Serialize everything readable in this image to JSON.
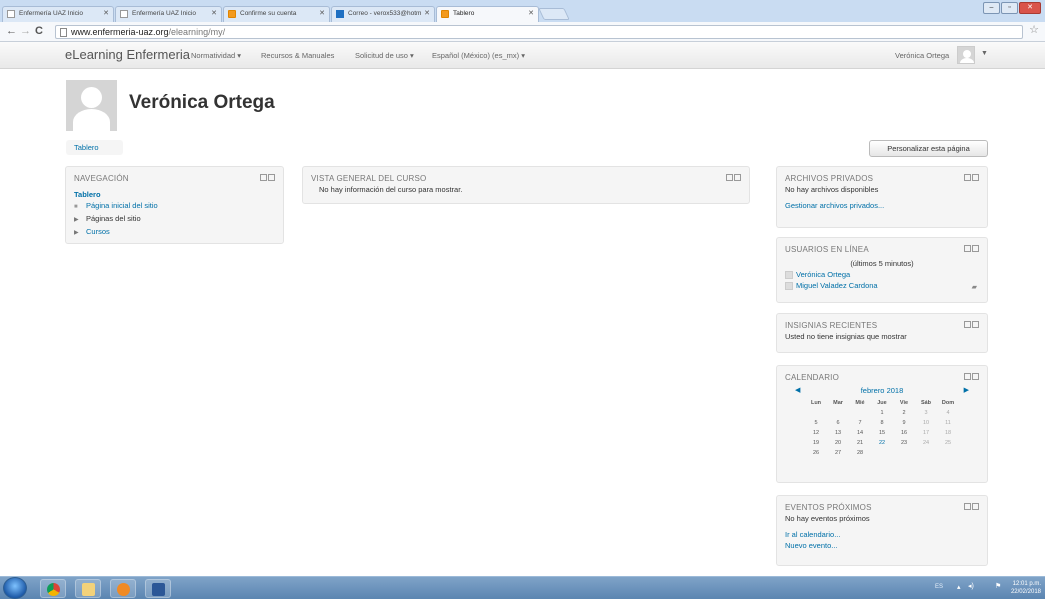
{
  "browser": {
    "tabs": [
      {
        "label": "Enfermería UAZ Inicio",
        "icon": "page-icon",
        "active": false
      },
      {
        "label": "Enfermería UAZ Inicio",
        "icon": "page-icon",
        "active": false
      },
      {
        "label": "Confirme su cuenta",
        "icon": "moodle-icon",
        "active": false
      },
      {
        "label": "Correo - verox533@hotm",
        "icon": "outlook-icon",
        "active": false
      },
      {
        "label": "Tablero",
        "icon": "moodle-icon",
        "active": true
      }
    ],
    "url_host": "www.enfermeria-uaz.org",
    "url_path": "/elearning/my/"
  },
  "navbar": {
    "brand": "eLearning Enfermeria",
    "links": [
      "Normatividad ▾",
      "Recursos & Manuales",
      "Solicitud de uso ▾",
      "Español (México) (es_mx) ▾"
    ],
    "user": "Verónica Ortega"
  },
  "header": {
    "name": "Verónica Ortega",
    "breadcrumb": "Tablero",
    "customize_button": "Personalizar esta página"
  },
  "navigation": {
    "title": "NAVEGACIÓN",
    "root": "Tablero",
    "items": [
      "Página inicial del sitio",
      "Páginas del sitio",
      "Cursos"
    ]
  },
  "course_overview": {
    "title": "VISTA GENERAL DEL CURSO",
    "message": "No hay información del curso para mostrar."
  },
  "private_files": {
    "title": "ARCHIVOS PRIVADOS",
    "message": "No hay archivos disponibles",
    "link": "Gestionar archivos privados..."
  },
  "online_users": {
    "title": "USUARIOS EN LÍNEA",
    "subtitle": "(últimos 5 minutos)",
    "users": [
      "Verónica Ortega",
      "Miguel Valadez Cardona"
    ]
  },
  "badges": {
    "title": "INSIGNIAS RECIENTES",
    "message": "Usted no tiene insignias que mostrar"
  },
  "calendar": {
    "title": "CALENDARIO",
    "month": "febrero 2018",
    "days_of_week": [
      "Lun",
      "Mar",
      "Mié",
      "Jue",
      "Vie",
      "Sáb",
      "Dom"
    ],
    "weeks": [
      [
        "",
        "",
        "",
        "1",
        "2",
        "3",
        "4"
      ],
      [
        "5",
        "6",
        "7",
        "8",
        "9",
        "10",
        "11"
      ],
      [
        "12",
        "13",
        "14",
        "15",
        "16",
        "17",
        "18"
      ],
      [
        "19",
        "20",
        "21",
        "22",
        "23",
        "24",
        "25"
      ],
      [
        "26",
        "27",
        "28",
        "",
        "",
        "",
        ""
      ]
    ],
    "today": "22"
  },
  "upcoming_events": {
    "title": "EVENTOS PRÓXIMOS",
    "message": "No hay eventos próximos",
    "link_calendar": "Ir al calendario...",
    "link_new": "Nuevo evento..."
  },
  "taskbar": {
    "language": "ES",
    "time": "12:01 p.m.",
    "date": "22/02/2018"
  }
}
